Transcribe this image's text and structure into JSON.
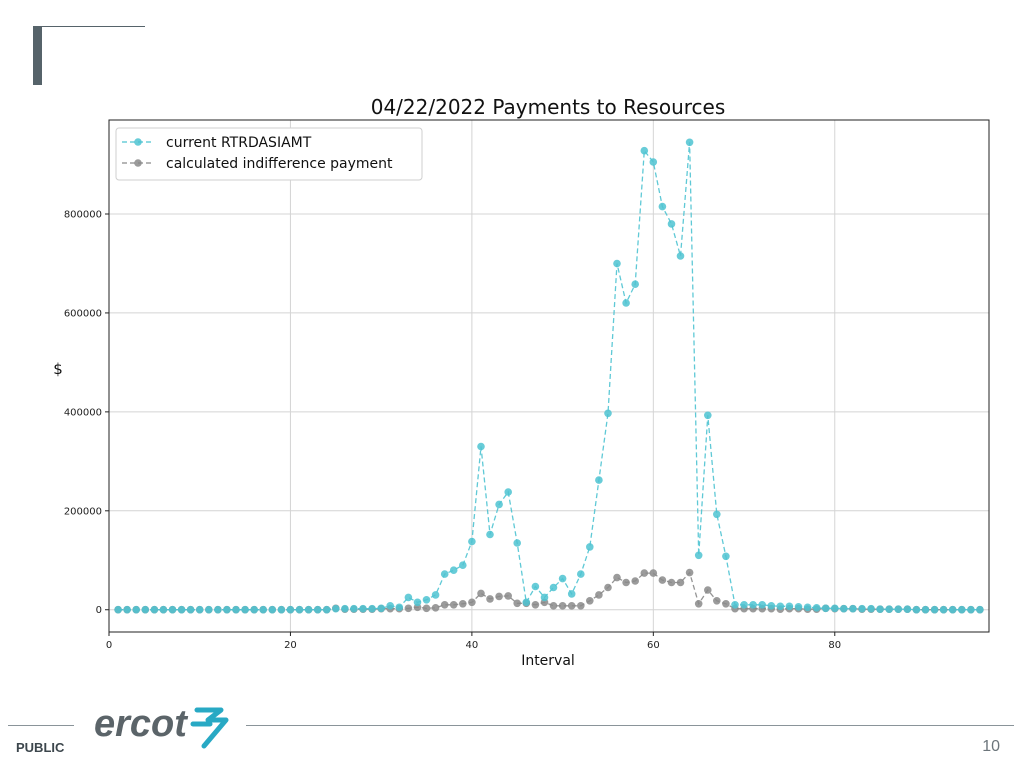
{
  "footer": {
    "classification": "PUBLIC",
    "logo_text": "ercot",
    "page_number": "10"
  },
  "colors": {
    "series_current": "#4ec3d1",
    "series_indifference": "#8a8a8a",
    "slide_accent": "#56636a"
  },
  "chart_data": {
    "type": "line",
    "title": "04/22/2022 Payments to Resources",
    "xlabel": "Interval",
    "ylabel": "$",
    "xlim": [
      0,
      97
    ],
    "ylim": [
      -45000,
      990000
    ],
    "xticks": [
      0,
      20,
      40,
      60,
      80
    ],
    "yticks": [
      0,
      200000,
      400000,
      600000,
      800000
    ],
    "grid": true,
    "legend_position": "top-left",
    "series": [
      {
        "name": "current RTRDASIAMT",
        "color": "#4ec3d1",
        "style": "dashed-marker",
        "x": [
          1,
          2,
          3,
          4,
          5,
          6,
          7,
          8,
          9,
          10,
          11,
          12,
          13,
          14,
          15,
          16,
          17,
          18,
          19,
          20,
          21,
          22,
          23,
          24,
          25,
          26,
          27,
          28,
          29,
          30,
          31,
          32,
          33,
          34,
          35,
          36,
          37,
          38,
          39,
          40,
          41,
          42,
          43,
          44,
          45,
          46,
          47,
          48,
          49,
          50,
          51,
          52,
          53,
          54,
          55,
          56,
          57,
          58,
          59,
          60,
          61,
          62,
          63,
          64,
          65,
          66,
          67,
          68,
          69,
          70,
          71,
          72,
          73,
          74,
          75,
          76,
          77,
          78,
          79,
          80,
          81,
          82,
          83,
          84,
          85,
          86,
          87,
          88,
          89,
          90,
          91,
          92,
          93,
          94,
          95,
          96
        ],
        "values": [
          0,
          0,
          0,
          0,
          0,
          0,
          0,
          0,
          0,
          0,
          0,
          0,
          0,
          0,
          0,
          0,
          0,
          0,
          0,
          0,
          0,
          0,
          0,
          0,
          2000,
          2000,
          2000,
          2000,
          2000,
          3000,
          8000,
          5000,
          25000,
          15000,
          20000,
          30000,
          72000,
          80000,
          90000,
          138000,
          330000,
          152000,
          213000,
          238000,
          135000,
          15000,
          47000,
          25000,
          45000,
          63000,
          32000,
          72000,
          127000,
          262000,
          397000,
          700000,
          620000,
          658000,
          928000,
          905000,
          815000,
          780000,
          715000,
          945000,
          110000,
          393000,
          193000,
          108000,
          10000,
          10000,
          10000,
          10000,
          8000,
          7000,
          7000,
          6000,
          5000,
          4000,
          3000,
          3000,
          2000,
          2000,
          2000,
          2000,
          1000,
          1000,
          1000,
          1000,
          0,
          0,
          0,
          0,
          0,
          0,
          0,
          0
        ]
      },
      {
        "name": "calculated indifference payment",
        "color": "#8a8a8a",
        "style": "dashed-marker",
        "x": [
          1,
          2,
          3,
          4,
          5,
          6,
          7,
          8,
          9,
          10,
          11,
          12,
          13,
          14,
          15,
          16,
          17,
          18,
          19,
          20,
          21,
          22,
          23,
          24,
          25,
          26,
          27,
          28,
          29,
          30,
          31,
          32,
          33,
          34,
          35,
          36,
          37,
          38,
          39,
          40,
          41,
          42,
          43,
          44,
          45,
          46,
          47,
          48,
          49,
          50,
          51,
          52,
          53,
          54,
          55,
          56,
          57,
          58,
          59,
          60,
          61,
          62,
          63,
          64,
          65,
          66,
          67,
          68,
          69,
          70,
          71,
          72,
          73,
          74,
          75,
          76,
          77,
          78,
          79,
          80,
          81,
          82,
          83,
          84,
          85,
          86,
          87,
          88,
          89,
          90,
          91,
          92,
          93,
          94,
          95,
          96
        ],
        "values": [
          0,
          0,
          0,
          0,
          0,
          0,
          0,
          0,
          0,
          0,
          0,
          0,
          0,
          0,
          0,
          0,
          0,
          0,
          0,
          0,
          0,
          0,
          0,
          0,
          3000,
          1000,
          1000,
          1000,
          1000,
          2000,
          2000,
          2000,
          3000,
          5000,
          3000,
          4000,
          10000,
          10000,
          12000,
          15000,
          33000,
          22000,
          27000,
          28000,
          13000,
          13000,
          10000,
          15000,
          8000,
          8000,
          8000,
          8000,
          18000,
          30000,
          45000,
          65000,
          55000,
          58000,
          74000,
          74000,
          60000,
          55000,
          55000,
          75000,
          12000,
          40000,
          18000,
          12000,
          2000,
          2000,
          2000,
          2000,
          2000,
          1000,
          2000,
          2000,
          1000,
          1000,
          3000,
          2000,
          2000,
          2000,
          1000,
          1000,
          1000,
          1000,
          1000,
          1000,
          0,
          0,
          0,
          0,
          0,
          0,
          0,
          0
        ]
      }
    ]
  }
}
